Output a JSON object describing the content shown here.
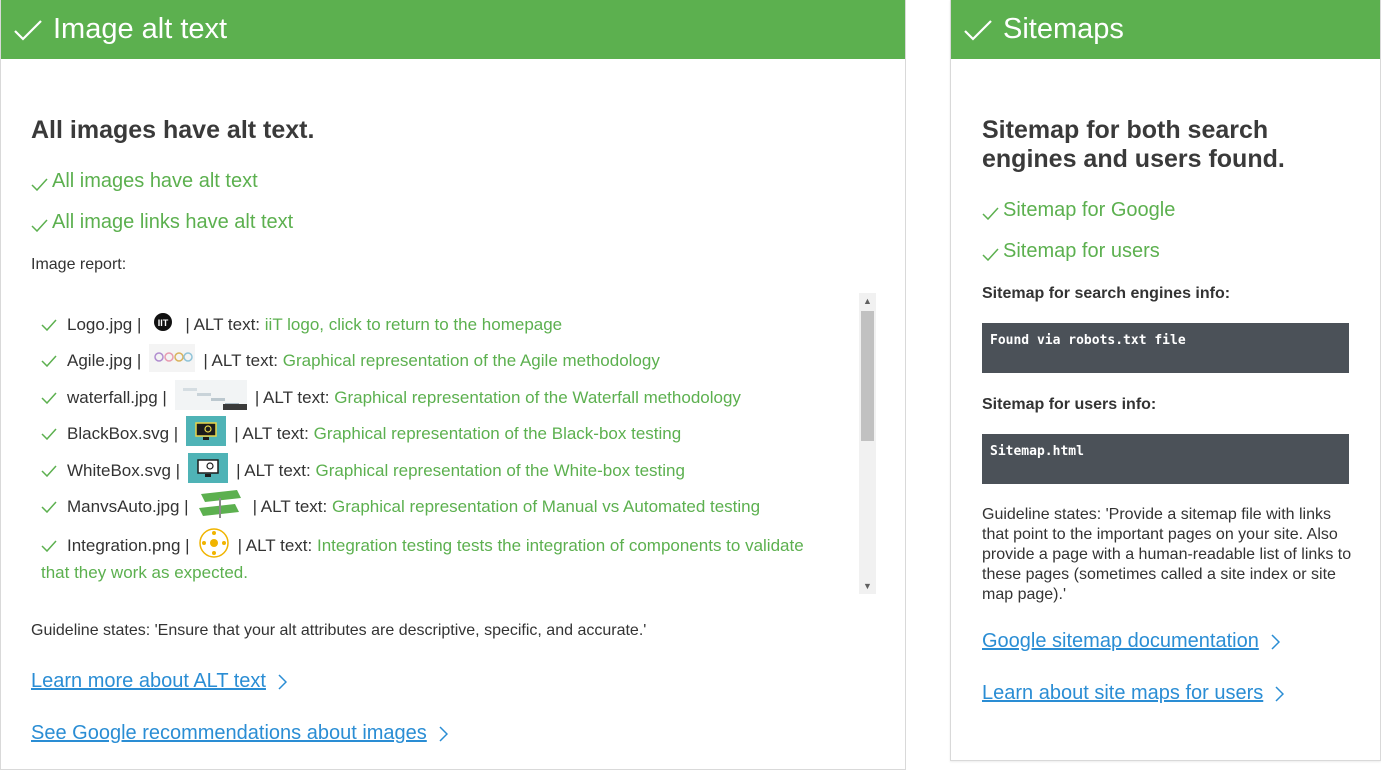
{
  "colors": {
    "green": "#5cb04f",
    "link": "#2a8dd4",
    "code_bg": "#4b5158"
  },
  "alt_card": {
    "header_title": "Image alt text",
    "heading": "All images have alt text.",
    "checks": [
      "All images have alt text",
      "All image links have alt text"
    ],
    "report_label": "Image report:",
    "report_items": [
      {
        "file": "Logo.jpg |",
        "alt_prefix": "| ALT text:",
        "alt": "iiT logo, click to return to the homepage",
        "thumb": "iit-logo-thumbnail"
      },
      {
        "file": "Agile.jpg |",
        "alt_prefix": "| ALT text:",
        "alt": "Graphical representation of the Agile methodology",
        "thumb": "agile-thumbnail"
      },
      {
        "file": "waterfall.jpg |",
        "alt_prefix": "| ALT text:",
        "alt": "Graphical representation of the Waterfall methodology",
        "thumb": "waterfall-thumbnail"
      },
      {
        "file": "BlackBox.svg |",
        "alt_prefix": "| ALT text:",
        "alt": "Graphical representation of the Black-box testing",
        "thumb": "blackbox-thumbnail"
      },
      {
        "file": "WhiteBox.svg |",
        "alt_prefix": "| ALT text:",
        "alt": "Graphical representation of the White-box testing",
        "thumb": "whitebox-thumbnail"
      },
      {
        "file": "ManvsAuto.jpg |",
        "alt_prefix": "| ALT text:",
        "alt": "Graphical representation of Manual vs Automated testing",
        "thumb": "manvsauto-thumbnail"
      },
      {
        "file": "Integration.png |",
        "alt_prefix": "| ALT text:",
        "alt": "Integration testing tests the integration of components to validate",
        "alt_cont": "that they work as expected.",
        "thumb": "integration-thumbnail"
      }
    ],
    "guideline": "Guideline states: 'Ensure that your alt attributes are descriptive, specific, and accurate.'",
    "links": [
      "Learn more about ALT text",
      "See Google recommendations about images"
    ]
  },
  "sitemap_card": {
    "header_title": "Sitemaps",
    "heading_line1": "Sitemap for both search",
    "heading_line2": "engines and users found.",
    "checks": [
      "Sitemap for Google",
      "Sitemap for users"
    ],
    "search_label": "Sitemap for search engines info:",
    "search_value": "Found via robots.txt file",
    "users_label": "Sitemap for users info:",
    "users_value": "Sitemap.html",
    "guideline": "Guideline states: 'Provide a sitemap file with links that point to the important pages on your site. Also provide a page with a human-readable list of links to these pages (sometimes called a site index or site map page).'",
    "links": [
      "Google sitemap documentation",
      "Learn about site maps for users"
    ]
  }
}
